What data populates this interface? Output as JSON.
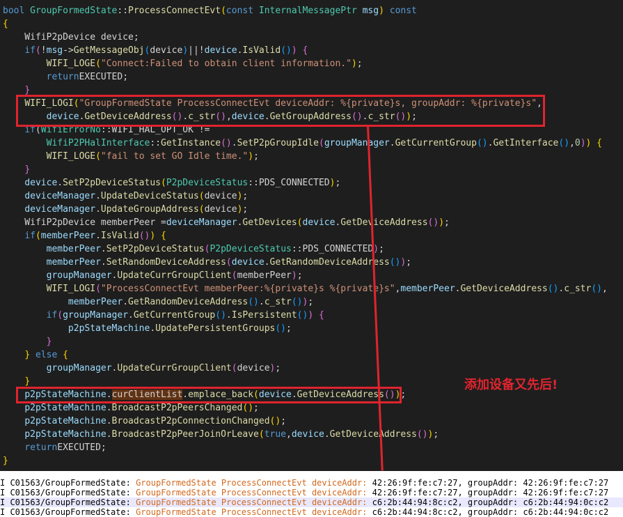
{
  "editor": {
    "lines": [
      [
        [
          "kw",
          "bool"
        ],
        [
          "",
          " "
        ],
        [
          "ty",
          "GroupFormedState"
        ],
        [
          "",
          "::"
        ],
        [
          "fn",
          "ProcessConnectEvt"
        ],
        [
          "pa",
          "("
        ],
        [
          "kw",
          "const"
        ],
        [
          "",
          " "
        ],
        [
          "ty",
          "InternalMessagePtr"
        ],
        [
          "",
          " "
        ],
        [
          "vr",
          "msg"
        ],
        [
          "pa",
          ")"
        ],
        [
          "",
          " "
        ],
        [
          "kw",
          "const"
        ]
      ],
      [
        [
          "pa",
          "{"
        ]
      ],
      [
        [
          "",
          "    WifiP2pDevice device;"
        ]
      ],
      [
        [
          "",
          "    "
        ],
        [
          "kw",
          "if"
        ],
        [
          "",
          ""
        ],
        [
          "pb",
          "("
        ],
        [
          "",
          "!"
        ],
        [
          "vr",
          "msg"
        ],
        [
          "",
          "->"
        ],
        [
          "fn",
          "GetMessageObj"
        ],
        [
          "pc",
          "("
        ],
        [
          "",
          "device"
        ],
        [
          "pc",
          ")"
        ],
        [
          "",
          "||!"
        ],
        [
          "vr",
          "device"
        ],
        [
          "",
          "."
        ],
        [
          "fn",
          "IsValid"
        ],
        [
          "pc",
          "()"
        ],
        [
          "pb",
          ")"
        ],
        [
          "",
          " "
        ],
        [
          "pb",
          "{"
        ]
      ],
      [
        [
          "",
          "        "
        ],
        [
          "fn",
          "WIFI_LOGE"
        ],
        [
          "pa",
          "("
        ],
        [
          "st",
          "\"Connect:Failed to obtain client information.\""
        ],
        [
          "pa",
          ")"
        ],
        [
          ";",
          ";"
        ]
      ],
      [
        [
          "",
          "        "
        ],
        [
          "kw",
          "return"
        ],
        [
          "",
          "EXECUTED;"
        ]
      ],
      [
        [
          "",
          "    "
        ],
        [
          "pb",
          "}"
        ]
      ],
      [
        [
          "",
          "    "
        ],
        [
          "fn",
          "WIFI_LOGI"
        ],
        [
          "pa",
          "("
        ],
        [
          "st",
          "\"GroupFormedState ProcessConnectEvt deviceAddr: %{private}s, groupAddr: %{private}s\""
        ],
        [
          "",
          ","
        ]
      ],
      [
        [
          "",
          "        "
        ],
        [
          "vr",
          "device"
        ],
        [
          "",
          "."
        ],
        [
          "fn",
          "GetDeviceAddress"
        ],
        [
          "pb",
          "()"
        ],
        [
          "",
          "."
        ],
        [
          "fn",
          "c_str"
        ],
        [
          "pb",
          "()"
        ],
        [
          "",
          ","
        ],
        [
          "vr",
          "device"
        ],
        [
          "",
          "."
        ],
        [
          "fn",
          "GetGroupAddress"
        ],
        [
          "pb",
          "()"
        ],
        [
          "",
          "."
        ],
        [
          "fn",
          "c_str"
        ],
        [
          "pb",
          "()"
        ],
        [
          "pa",
          ")"
        ],
        [
          "",
          ";"
        ]
      ],
      [
        [
          "",
          "    "
        ],
        [
          "kw",
          "if"
        ],
        [
          "",
          "("
        ],
        [
          "ty",
          "WifiErrorNo"
        ],
        [
          "",
          "::WIFI_HAL_OPT_OK !="
        ]
      ],
      [
        [
          "",
          "        "
        ],
        [
          "ty",
          "WifiP2PHalInterface"
        ],
        [
          "",
          "::"
        ],
        [
          "fn",
          "GetInstance"
        ],
        [
          "pb",
          "()"
        ],
        [
          "",
          "."
        ],
        [
          "fn",
          "SetP2pGroupIdle"
        ],
        [
          "pb",
          "("
        ],
        [
          "vr",
          "groupManager"
        ],
        [
          "",
          "."
        ],
        [
          "fn",
          "GetCurrentGroup"
        ],
        [
          "pc",
          "()"
        ],
        [
          "",
          "."
        ],
        [
          "fn",
          "GetInterface"
        ],
        [
          "pc",
          "()"
        ],
        [
          "",
          ","
        ],
        [
          "nm",
          "0"
        ],
        [
          "pb",
          ")"
        ],
        [
          "pa",
          ")"
        ],
        [
          "",
          " "
        ],
        [
          "pa",
          "{"
        ]
      ],
      [
        [
          "",
          "        "
        ],
        [
          "fn",
          "WIFI_LOGE"
        ],
        [
          "pa",
          "("
        ],
        [
          "st",
          "\"fail to set GO Idle time.\""
        ],
        [
          "pa",
          ")"
        ],
        [
          "",
          ";"
        ]
      ],
      [
        [
          "",
          "    "
        ],
        [
          "pb",
          "}"
        ]
      ],
      [
        [
          "",
          "    "
        ],
        [
          "vr",
          "device"
        ],
        [
          "",
          "."
        ],
        [
          "fn",
          "SetP2pDeviceStatus"
        ],
        [
          "pa",
          "("
        ],
        [
          "ty",
          "P2pDeviceStatus"
        ],
        [
          "",
          "::PDS_CONNECTED"
        ],
        [
          "pa",
          ")"
        ],
        [
          "",
          ";"
        ]
      ],
      [
        [
          "",
          "    "
        ],
        [
          "vr",
          "deviceManager"
        ],
        [
          "",
          "."
        ],
        [
          "fn",
          "UpdateDeviceStatus"
        ],
        [
          "pa",
          "("
        ],
        [
          "",
          "device"
        ],
        [
          "pa",
          ")"
        ],
        [
          "",
          ";"
        ]
      ],
      [
        [
          "",
          "    "
        ],
        [
          "vr",
          "deviceManager"
        ],
        [
          "",
          "."
        ],
        [
          "fn",
          "UpdateGroupAddress"
        ],
        [
          "pa",
          "("
        ],
        [
          "",
          "device"
        ],
        [
          "pa",
          ")"
        ],
        [
          "",
          ";"
        ]
      ],
      [
        [
          "",
          "    WifiP2pDevice memberPeer ="
        ],
        [
          "vr",
          "deviceManager"
        ],
        [
          "",
          "."
        ],
        [
          "fn",
          "GetDevices"
        ],
        [
          "pa",
          "("
        ],
        [
          "vr",
          "device"
        ],
        [
          "",
          "."
        ],
        [
          "fn",
          "GetDeviceAddress"
        ],
        [
          "pb",
          "()"
        ],
        [
          "pa",
          ")"
        ],
        [
          "",
          ";"
        ]
      ],
      [
        [
          "",
          "    "
        ],
        [
          "kw",
          "if"
        ],
        [
          "pa",
          "("
        ],
        [
          "vr",
          "memberPeer"
        ],
        [
          "",
          "."
        ],
        [
          "fn",
          "IsValid"
        ],
        [
          "pb",
          "()"
        ],
        [
          "pa",
          ")"
        ],
        [
          "",
          " "
        ],
        [
          "pa",
          "{"
        ]
      ],
      [
        [
          "",
          "        "
        ],
        [
          "vr",
          "memberPeer"
        ],
        [
          "",
          "."
        ],
        [
          "fn",
          "SetP2pDeviceStatus"
        ],
        [
          "pb",
          "("
        ],
        [
          "ty",
          "P2pDeviceStatus"
        ],
        [
          "",
          "::PDS_CONNECTED"
        ],
        [
          "pb",
          ")"
        ],
        [
          "",
          ";"
        ]
      ],
      [
        [
          "",
          "        "
        ],
        [
          "vr",
          "memberPeer"
        ],
        [
          "",
          "."
        ],
        [
          "fn",
          "SetRandomDeviceAddress"
        ],
        [
          "pb",
          "("
        ],
        [
          "vr",
          "device"
        ],
        [
          "",
          "."
        ],
        [
          "fn",
          "GetRandomDeviceAddress"
        ],
        [
          "pc",
          "()"
        ],
        [
          "pb",
          ")"
        ],
        [
          "",
          ";"
        ]
      ],
      [
        [
          "",
          "        "
        ],
        [
          "vr",
          "groupManager"
        ],
        [
          "",
          "."
        ],
        [
          "fn",
          "UpdateCurrGroupClient"
        ],
        [
          "pb",
          "("
        ],
        [
          "",
          "memberPeer"
        ],
        [
          "pb",
          ")"
        ],
        [
          "",
          ";"
        ]
      ],
      [
        [
          "",
          "        "
        ],
        [
          "fn",
          "WIFI_LOGI"
        ],
        [
          "pb",
          "("
        ],
        [
          "st",
          "\"ProcessConnectEvt memberPeer:%{private}s %{private}s\""
        ],
        [
          "",
          ","
        ],
        [
          "vr",
          "memberPeer"
        ],
        [
          "",
          "."
        ],
        [
          "fn",
          "GetDeviceAddress"
        ],
        [
          "pc",
          "()"
        ],
        [
          "",
          "."
        ],
        [
          "fn",
          "c_str"
        ],
        [
          "pc",
          "()"
        ],
        [
          "",
          ","
        ]
      ],
      [
        [
          "",
          "            "
        ],
        [
          "vr",
          "memberPeer"
        ],
        [
          "",
          "."
        ],
        [
          "fn",
          "GetRandomDeviceAddress"
        ],
        [
          "pc",
          "()"
        ],
        [
          "",
          "."
        ],
        [
          "fn",
          "c_str"
        ],
        [
          "pc",
          "()"
        ],
        [
          "pb",
          ")"
        ],
        [
          "",
          ";"
        ]
      ],
      [
        [
          "",
          "        "
        ],
        [
          "kw",
          "if"
        ],
        [
          "pb",
          "("
        ],
        [
          "vr",
          "groupManager"
        ],
        [
          "",
          "."
        ],
        [
          "fn",
          "GetCurrentGroup"
        ],
        [
          "pc",
          "()"
        ],
        [
          "",
          "."
        ],
        [
          "fn",
          "IsPersistent"
        ],
        [
          "pc",
          "()"
        ],
        [
          "pb",
          ")"
        ],
        [
          "",
          " "
        ],
        [
          "pb",
          "{"
        ]
      ],
      [
        [
          "",
          "            "
        ],
        [
          "vr",
          "p2pStateMachine"
        ],
        [
          "",
          "."
        ],
        [
          "fn",
          "UpdatePersistentGroups"
        ],
        [
          "pc",
          "()"
        ],
        [
          "",
          ";"
        ]
      ],
      [
        [
          "",
          "        "
        ],
        [
          "pb",
          "}"
        ]
      ],
      [
        [
          "",
          "    "
        ],
        [
          "pa",
          "}"
        ],
        [
          "",
          " "
        ],
        [
          "kw",
          "else"
        ],
        [
          "",
          " "
        ],
        [
          "pa",
          "{"
        ]
      ],
      [
        [
          "",
          "        "
        ],
        [
          "vr",
          "groupManager"
        ],
        [
          "",
          "."
        ],
        [
          "fn",
          "UpdateCurrGroupClient"
        ],
        [
          "pb",
          "("
        ],
        [
          "",
          "device"
        ],
        [
          "pb",
          ")"
        ],
        [
          "",
          ";"
        ]
      ],
      [
        [
          "",
          "    "
        ],
        [
          "pa",
          "}"
        ]
      ],
      [
        [
          "",
          "    "
        ],
        [
          "vr",
          "p2pStateMachine"
        ],
        [
          "",
          "."
        ],
        [
          "hl",
          "curClientList"
        ],
        [
          "",
          "."
        ],
        [
          "fn",
          "emplace_back"
        ],
        [
          "pa",
          "("
        ],
        [
          "vr",
          "device"
        ],
        [
          "",
          "."
        ],
        [
          "fn",
          "GetDeviceAddress"
        ],
        [
          "pb",
          "()"
        ],
        [
          "pa",
          ")"
        ],
        [
          "",
          ";"
        ]
      ],
      [
        [
          "",
          "    "
        ],
        [
          "vr",
          "p2pStateMachine"
        ],
        [
          "",
          "."
        ],
        [
          "fn",
          "BroadcastP2pPeersChanged"
        ],
        [
          "pa",
          "()"
        ],
        [
          "",
          ";"
        ]
      ],
      [
        [
          "",
          "    "
        ],
        [
          "vr",
          "p2pStateMachine"
        ],
        [
          "",
          "."
        ],
        [
          "fn",
          "BroadcastP2pConnectionChanged"
        ],
        [
          "pa",
          "()"
        ],
        [
          "",
          ";"
        ]
      ],
      [
        [
          "",
          "    "
        ],
        [
          "vr",
          "p2pStateMachine"
        ],
        [
          "",
          "."
        ],
        [
          "fn",
          "BroadcastP2pPeerJoinOrLeave"
        ],
        [
          "pa",
          "("
        ],
        [
          "kw",
          "true"
        ],
        [
          "",
          ","
        ],
        [
          "vr",
          "device"
        ],
        [
          "",
          "."
        ],
        [
          "fn",
          "GetDeviceAddress"
        ],
        [
          "pb",
          "()"
        ],
        [
          "pa",
          ")"
        ],
        [
          "",
          ";"
        ]
      ],
      [
        [
          "",
          "    "
        ],
        [
          "kw",
          "return"
        ],
        [
          "",
          "EXECUTED;"
        ]
      ],
      [
        [
          "pa",
          "}"
        ]
      ]
    ]
  },
  "annotation": "添加设备又先后!",
  "log": {
    "lines": [
      {
        "prefix": "I C01563/GroupFormedState: ",
        "highlight": "GroupFormedState ProcessConnectEvt deviceAddr:",
        "rest": " 42:26:9f:fe:c7:27, groupAddr: 42:26:9f:fe:c7:27",
        "selected": false
      },
      {
        "prefix": "I C01563/GroupFormedState: ",
        "highlight": "GroupFormedState ProcessConnectEvt deviceAddr:",
        "rest": " 42:26:9f:fe:c7:27, groupAddr: 42:26:9f:fe:c7:27",
        "selected": false
      },
      {
        "prefix": "I C01563/GroupFormedState: ",
        "highlight": "GroupFormedState ProcessConnectEvt deviceAddr:",
        "rest": " c6:2b:44:94:8c:c2, groupAddr: c6:2b:44:94:0c:c2",
        "selected": true
      },
      {
        "prefix": "I C01563/GroupFormedState: ",
        "highlight": "GroupFormedState ProcessConnectEvt deviceAddr:",
        "rest": " c6:2b:44:94:8c:c2, groupAddr: c6:2b:44:94:0c:c2",
        "selected": false
      }
    ]
  },
  "colors": {
    "annotation_red": "#e0242e",
    "editor_bg": "#1e1e1e",
    "log_highlight": "#d2691e"
  }
}
